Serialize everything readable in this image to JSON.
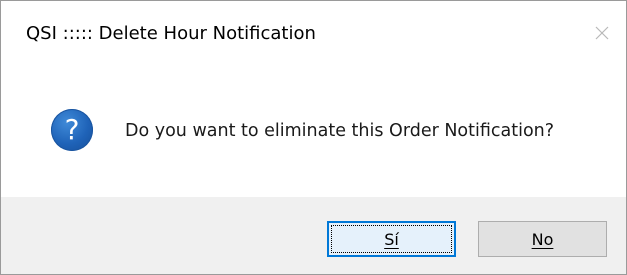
{
  "window": {
    "title": "QSI ::::: Delete Hour Notification",
    "close_icon": "close-icon"
  },
  "dialog": {
    "icon": "question-icon",
    "icon_glyph": "?",
    "message": "Do you want to eliminate this Order Notification?"
  },
  "buttons": {
    "yes_label": "Sí",
    "no_label": "No"
  },
  "colors": {
    "icon_blue": "#1f63b8",
    "default_button_border": "#0078d7",
    "footer_bg": "#f0f0f0"
  }
}
